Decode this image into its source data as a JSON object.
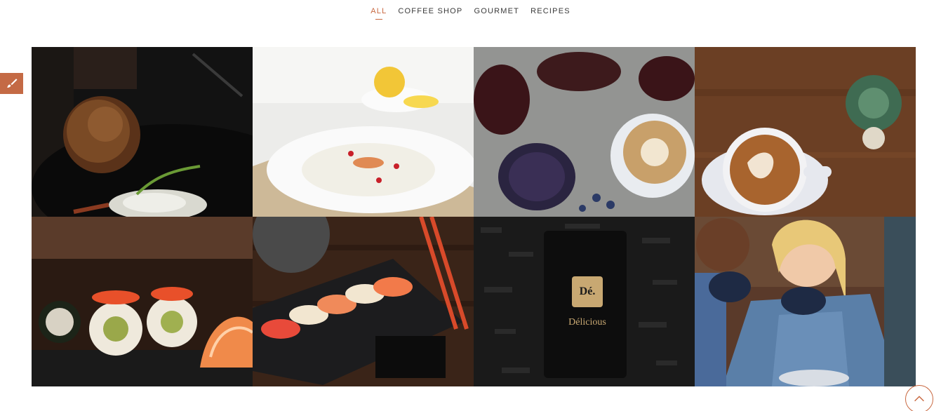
{
  "filters": {
    "items": [
      "ALL",
      "COFFEE SHOP",
      "GOURMET",
      "RECIPES"
    ],
    "active": "ALL"
  },
  "colors": {
    "accent": "#c8673f",
    "side_tab": "#c46a45"
  },
  "side_tab": {
    "icon": "paintbrush-icon"
  },
  "gallery": {
    "tiles": [
      {
        "subject": "fried-food-dark-plate"
      },
      {
        "subject": "white-soup-bowl-lemon"
      },
      {
        "subject": "blueberry-toast-latte"
      },
      {
        "subject": "latte-art-wood-table"
      },
      {
        "subject": "sushi-rolls"
      },
      {
        "subject": "nigiri-sushi-board"
      },
      {
        "subject": "tea-package",
        "package_brand": "Dé.",
        "package_name": "Délicious"
      },
      {
        "subject": "friends-drinking-coffee"
      }
    ]
  },
  "scroll_top": {
    "icon": "chevron-up-icon"
  }
}
